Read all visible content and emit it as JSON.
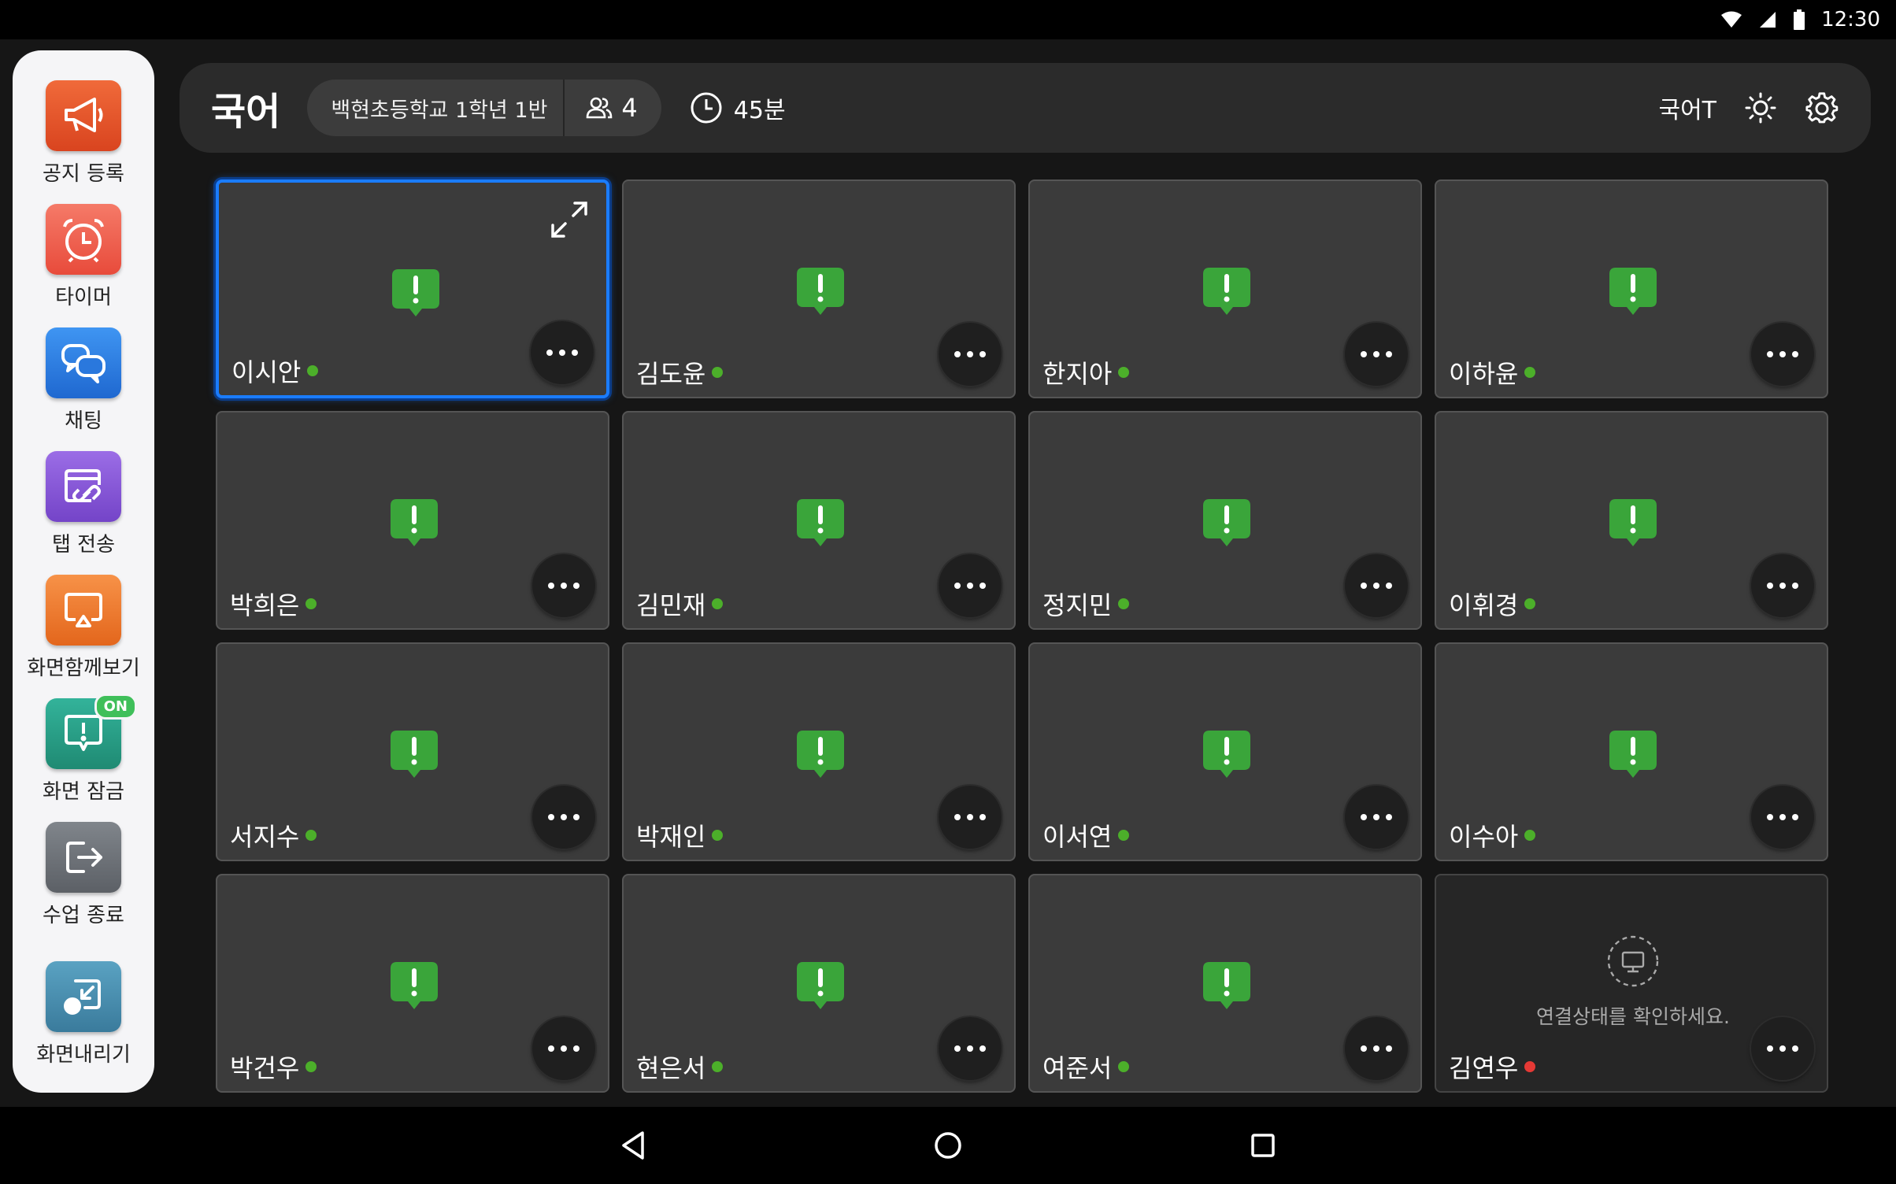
{
  "status_bar": {
    "time": "12:30"
  },
  "sidebar": {
    "items": [
      {
        "label": "공지 등록",
        "icon": "megaphone-icon",
        "color": "#e8532b"
      },
      {
        "label": "타이머",
        "icon": "alarm-clock-icon",
        "color": "#f05a4a"
      },
      {
        "label": "채팅",
        "icon": "chat-bubbles-icon",
        "color": "#2f7fe0"
      },
      {
        "label": "탭 전송",
        "icon": "link-send-icon",
        "color": "#8a5ad8"
      },
      {
        "label": "화면함께보기",
        "icon": "screen-share-icon",
        "color": "#f07a2e"
      },
      {
        "label": "화면 잠금",
        "icon": "screen-lock-icon",
        "color": "#2aa189",
        "badge": "ON"
      },
      {
        "label": "수업 종료",
        "icon": "exit-icon",
        "color": "#6f7379"
      },
      {
        "label": "화면내리기",
        "icon": "minimize-screen-icon",
        "color": "#4a8fb0"
      }
    ]
  },
  "header": {
    "subject": "국어",
    "class_name": "백현초등학교 1학년 1반",
    "student_count": "4",
    "duration": "45분",
    "teacher": "국어T"
  },
  "students": [
    {
      "name": "이시안",
      "status": "online",
      "selected": true
    },
    {
      "name": "김도윤",
      "status": "online"
    },
    {
      "name": "한지아",
      "status": "online"
    },
    {
      "name": "이하윤",
      "status": "online"
    },
    {
      "name": "박희은",
      "status": "online"
    },
    {
      "name": "김민재",
      "status": "online"
    },
    {
      "name": "정지민",
      "status": "online"
    },
    {
      "name": "이휘경",
      "status": "online"
    },
    {
      "name": "서지수",
      "status": "online"
    },
    {
      "name": "박재인",
      "status": "online"
    },
    {
      "name": "이서연",
      "status": "online"
    },
    {
      "name": "이수아",
      "status": "online"
    },
    {
      "name": "박건우",
      "status": "online"
    },
    {
      "name": "현은서",
      "status": "online"
    },
    {
      "name": "여준서",
      "status": "online"
    },
    {
      "name": "김연우",
      "status": "offline",
      "message": "연결상태를 확인하세요."
    }
  ],
  "colors": {
    "online": "#4caf2a",
    "offline": "#e53935",
    "alert_green": "#3aa53a",
    "selected_border": "#1a7cff"
  }
}
